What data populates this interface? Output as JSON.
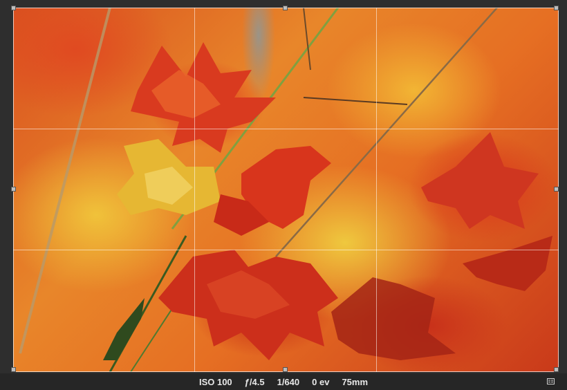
{
  "exif": {
    "iso": "ISO 100",
    "aperture": "ƒ/4.5",
    "shutter": "1/640",
    "exposure_bias": "0 ev",
    "focal_length": "75mm"
  },
  "icons": {
    "info_toggle": "info-panel-icon"
  },
  "colors": {
    "background": "#2e2e2e",
    "info_bar": "#262626",
    "grid_line": "#ffffff",
    "handle": "#bdbdbd"
  }
}
